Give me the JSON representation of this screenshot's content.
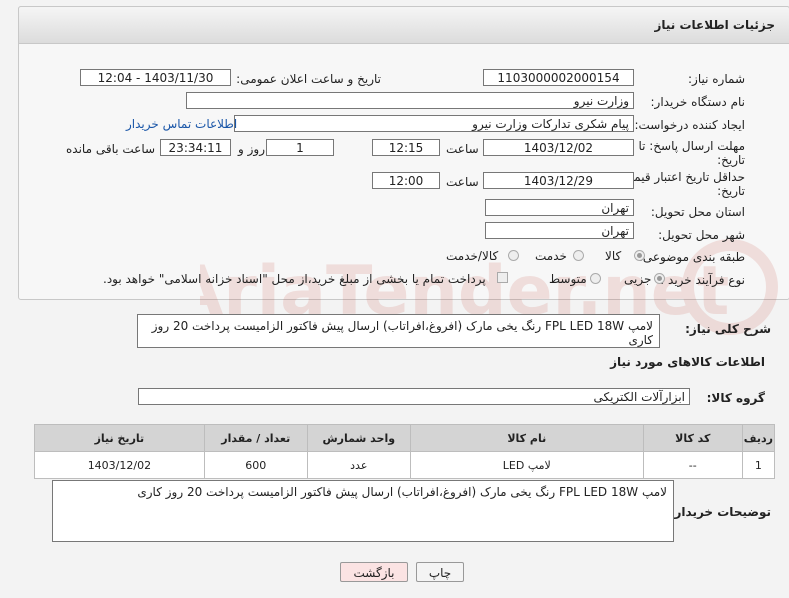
{
  "panel": {
    "title": "جزئیات اطلاعات نیاز"
  },
  "form": {
    "need_number_label": "شماره نیاز:",
    "need_number": "1103000002000154",
    "announce_label": "تاریخ و ساعت اعلان عمومی:",
    "announce_value": "1403/11/30 - 12:04",
    "buyer_org_label": "نام دستگاه خریدار:",
    "buyer_org": "وزارت نیرو",
    "creator_label": "ایجاد کننده درخواست:",
    "creator": "پیام شکری تدارکات وزارت نیرو",
    "contact_link": "اطلاعات تماس خریدار",
    "deadline_label_1": "مهلت ارسال پاسخ: تا",
    "deadline_label_2": "تاریخ:",
    "deadline_date": "1403/12/02",
    "time_label": "ساعت",
    "deadline_time": "12:15",
    "days_value": "1",
    "days_label": "روز و",
    "remaining_time": "23:34:11",
    "remaining_label": "ساعت باقی مانده",
    "validity_label_1": "حداقل تاریخ اعتبار قیمت: تا",
    "validity_label_2": "تاریخ:",
    "validity_date": "1403/12/29",
    "validity_time": "12:00",
    "province_label": "استان محل تحویل:",
    "province": "تهران",
    "city_label": "شهر محل تحویل:",
    "city": "تهران",
    "category_label": "طبقه بندی موضوعی:",
    "category_options": [
      "کالا",
      "خدمت",
      "کالا/خدمت"
    ],
    "process_label": "نوع فرآیند خرید :",
    "process_options": [
      "جزیی",
      "متوسط"
    ],
    "payment_note": "پرداخت تمام یا بخشی از مبلغ خرید،از محل \"اسناد خزانه اسلامی\" خواهد بود."
  },
  "description": {
    "label": "شرح کلی نیاز:",
    "text": "لامپ FPL LED 18W رنگ یخی مارک (افروغ،افراتاب) ارسال پیش فاکتور الزامیست پرداخت 20 روز کاری"
  },
  "items_section": {
    "title": "اطلاعات کالاهای مورد نیاز",
    "group_label": "گروه کالا:",
    "group_value": "ابزارآلات الکتریکی",
    "headers": [
      "ردیف",
      "کد کالا",
      "نام کالا",
      "واحد شمارش",
      "تعداد / مقدار",
      "تاریخ نیاز"
    ],
    "rows": [
      [
        "1",
        "--",
        "لامپ LED",
        "عدد",
        "600",
        "1403/12/02"
      ]
    ]
  },
  "buyer_notes": {
    "label": "توضیحات خریدار:",
    "text": "لامپ FPL LED 18W رنگ یخی مارک (افروغ،افراتاب) ارسال پیش فاکتور الزامیست پرداخت 20 روز کاری"
  },
  "buttons": {
    "print": "چاپ",
    "back": "بازگشت"
  },
  "watermark": {
    "text": "AriaTender.net"
  }
}
